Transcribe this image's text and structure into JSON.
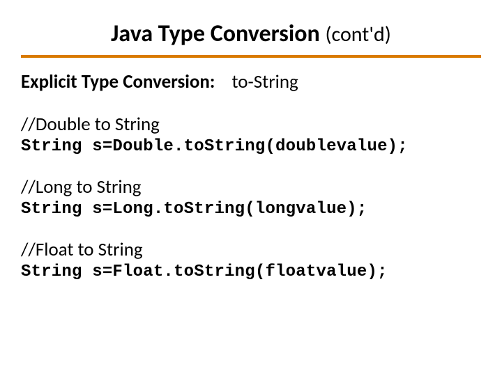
{
  "title": {
    "main": "Java Type Conversion",
    "suffix": "(cont'd)"
  },
  "subhead": {
    "label": "Explicit Type Conversion:",
    "value": "to-String"
  },
  "examples": [
    {
      "comment": "//Double to String",
      "code": "String s=Double.toString(doublevalue);"
    },
    {
      "comment": "//Long to String",
      "code": "String s=Long.toString(longvalue);"
    },
    {
      "comment": "//Float to String",
      "code": "String s=Float.toString(floatvalue);"
    }
  ]
}
